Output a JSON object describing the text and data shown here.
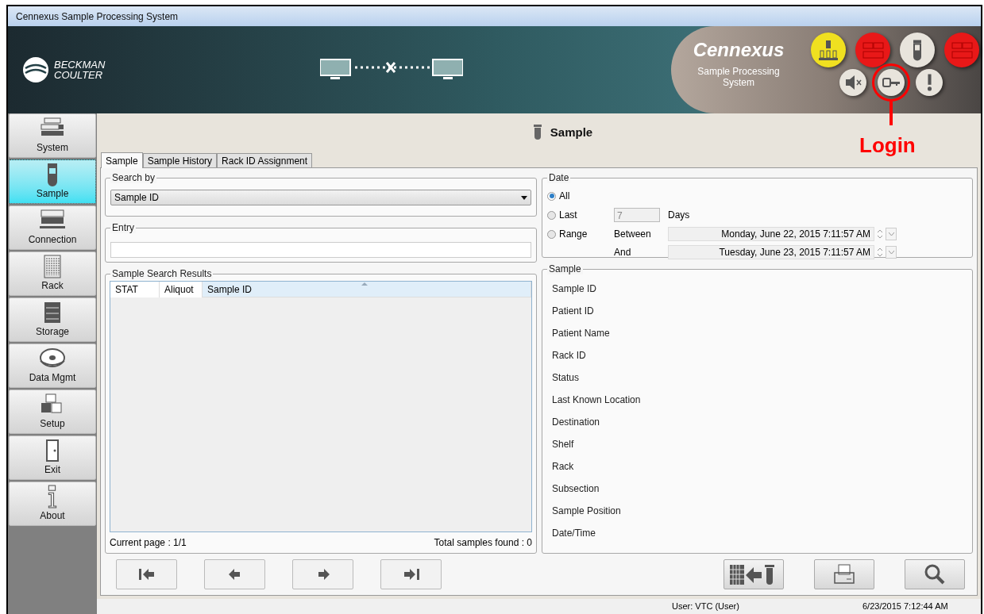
{
  "window": {
    "title": "Cennexus Sample Processing System"
  },
  "header": {
    "brand": "BECKMAN COULTER",
    "product": "Cennexus",
    "subtitle": "Sample Processing System",
    "status_buttons": [
      {
        "kind": "pipette",
        "color": "#f0e020"
      },
      {
        "kind": "network",
        "color": "#e81818"
      },
      {
        "kind": "tube",
        "color": "#e8e4dc"
      },
      {
        "kind": "network",
        "color": "#e81818"
      }
    ],
    "tool_buttons": [
      {
        "kind": "mute"
      },
      {
        "kind": "key"
      },
      {
        "kind": "alert"
      }
    ]
  },
  "annotation": {
    "label": "Login"
  },
  "sidebar": {
    "items": [
      {
        "label": "System",
        "kind": "system",
        "selected": false
      },
      {
        "label": "Sample",
        "kind": "tube",
        "selected": true
      },
      {
        "label": "Connection",
        "kind": "connection",
        "selected": false
      },
      {
        "label": "Rack",
        "kind": "rack",
        "selected": false
      },
      {
        "label": "Storage",
        "kind": "storage",
        "selected": false
      },
      {
        "label": "Data Mgmt",
        "kind": "disc",
        "selected": false
      },
      {
        "label": "Setup",
        "kind": "boxes",
        "selected": false
      },
      {
        "label": "Exit",
        "kind": "door",
        "selected": false
      },
      {
        "label": "About",
        "kind": "info",
        "selected": false
      }
    ]
  },
  "page": {
    "title": "Sample"
  },
  "tabs": [
    {
      "label": "Sample",
      "selected": true
    },
    {
      "label": "Sample History",
      "selected": false
    },
    {
      "label": "Rack ID Assignment",
      "selected": false
    }
  ],
  "search_by": {
    "legend": "Search by",
    "value": "Sample ID"
  },
  "entry": {
    "legend": "Entry"
  },
  "results": {
    "legend": "Sample Search Results",
    "columns": [
      "STAT",
      "Aliquot",
      "Sample ID"
    ],
    "current_page": "Current page : 1/1",
    "total": "Total samples found : 0"
  },
  "nav_buttons": [
    {
      "kind": "first"
    },
    {
      "kind": "prev"
    },
    {
      "kind": "next"
    },
    {
      "kind": "last"
    }
  ],
  "date": {
    "legend": "Date",
    "options": [
      {
        "label": "All",
        "selected": true
      },
      {
        "label": "Last",
        "selected": false
      },
      {
        "label": "Range",
        "selected": false
      }
    ],
    "days_value": "7",
    "days_label": "Days",
    "between_label": "Between",
    "between_value": "Monday, June 22, 2015 7:11:57 AM",
    "and_label": "And",
    "and_value": "Tuesday, June 23, 2015 7:11:57 AM"
  },
  "sample": {
    "legend": "Sample",
    "fields": [
      "Sample ID",
      "Patient ID",
      "Patient Name",
      "Rack ID",
      "Status",
      "Last Known Location",
      "Destination",
      "Shelf",
      "Rack",
      "Subsection",
      "Sample Position",
      "Date/Time"
    ]
  },
  "action_buttons": [
    {
      "kind": "assign"
    },
    {
      "kind": "print"
    },
    {
      "kind": "search"
    }
  ],
  "status_bar": {
    "user": "User: VTC  (User)",
    "time": "6/23/2015 7:12:44 AM"
  }
}
